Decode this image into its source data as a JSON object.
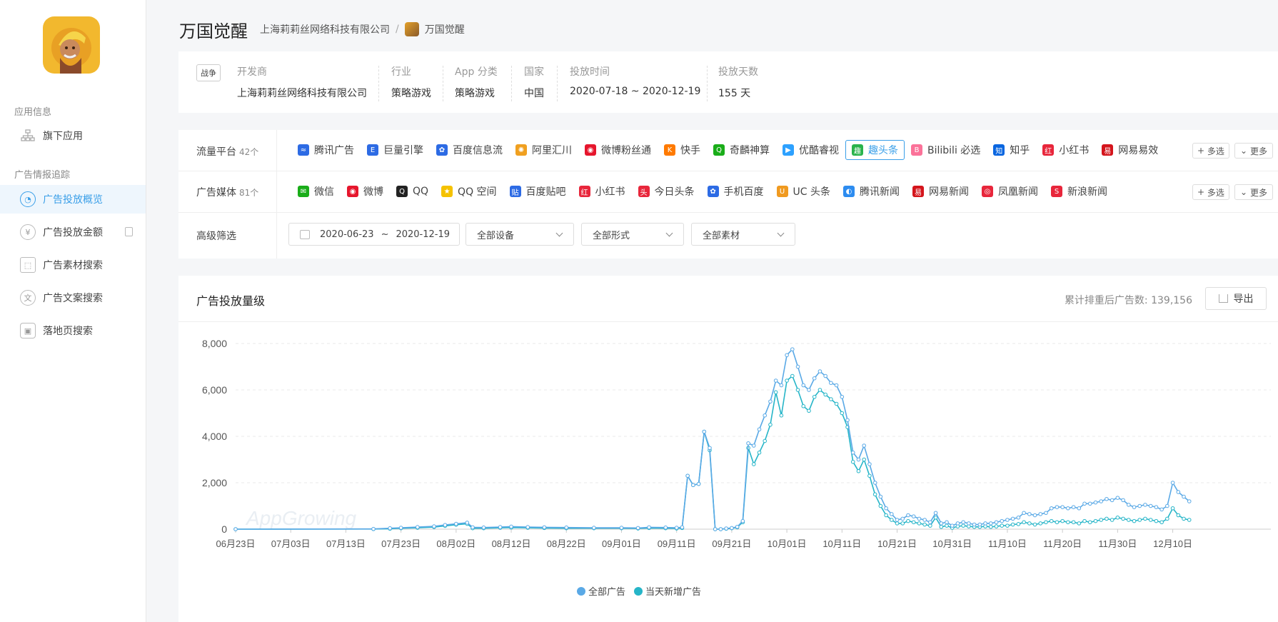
{
  "sidebar": {
    "section_app": "应用信息",
    "item_sub_apps": "旗下应用",
    "section_ad": "广告情报追踪",
    "items": [
      {
        "label": "广告投放概览"
      },
      {
        "label": "广告投放金额"
      },
      {
        "label": "广告素材搜索"
      },
      {
        "label": "广告文案搜索"
      },
      {
        "label": "落地页搜索"
      }
    ]
  },
  "header": {
    "title": "万国觉醒",
    "crumb_company": "上海莉莉丝网络科技有限公司",
    "crumb_sep": "/",
    "crumb_app": "万国觉醒"
  },
  "info": {
    "genre_tag": "战争",
    "fields": [
      {
        "label": "开发商",
        "value": "上海莉莉丝网络科技有限公司"
      },
      {
        "label": "行业",
        "value": "策略游戏"
      },
      {
        "label": "App 分类",
        "value": "策略游戏"
      },
      {
        "label": "国家",
        "value": "中国"
      },
      {
        "label": "投放时间",
        "value": "2020-07-18 ~ 2020-12-19"
      },
      {
        "label": "投放天数",
        "value": "155 天"
      }
    ]
  },
  "filters": {
    "platform_label": "流量平台",
    "platform_count": "42个",
    "platforms": [
      {
        "label": "腾讯广告",
        "icon": "tencent-ads-icon",
        "color": "#2d6be4",
        "glyph": "≈"
      },
      {
        "label": "巨量引擎",
        "icon": "ocean-engine-icon",
        "color": "#2d6be4",
        "glyph": "E"
      },
      {
        "label": "百度信息流",
        "icon": "baidu-paw-icon",
        "color": "#2d6be4",
        "glyph": "✿"
      },
      {
        "label": "阿里汇川",
        "icon": "ali-huichuan-icon",
        "color": "#f0a020",
        "glyph": "✺"
      },
      {
        "label": "微博粉丝通",
        "icon": "weibo-icon",
        "color": "#e6162d",
        "glyph": "◉"
      },
      {
        "label": "快手",
        "icon": "kuaishou-icon",
        "color": "#ff7a00",
        "glyph": "K"
      },
      {
        "label": "奇麟神算",
        "icon": "qilin-icon",
        "color": "#1aad19",
        "glyph": "Q"
      },
      {
        "label": "优酷睿视",
        "icon": "youku-icon",
        "color": "#2da1ff",
        "glyph": "▶"
      },
      {
        "label": "趣头条",
        "icon": "qutoutiao-icon",
        "color": "#29b34b",
        "glyph": "趣",
        "selected": true
      },
      {
        "label": "Bilibili 必选",
        "icon": "bilibili-icon",
        "color": "#fb7299",
        "glyph": "B"
      },
      {
        "label": "知乎",
        "icon": "zhihu-icon",
        "color": "#0a66e0",
        "glyph": "知"
      },
      {
        "label": "小红书",
        "icon": "xiaohongshu-icon",
        "color": "#e8263b",
        "glyph": "红"
      },
      {
        "label": "网易易效",
        "icon": "netease-icon",
        "color": "#d4151c",
        "glyph": "易"
      }
    ],
    "media_label": "广告媒体",
    "media_count": "81个",
    "media": [
      {
        "label": "微信",
        "icon": "wechat-icon",
        "color": "#1aad19",
        "glyph": "✉"
      },
      {
        "label": "微博",
        "icon": "weibo-icon",
        "color": "#e6162d",
        "glyph": "◉"
      },
      {
        "label": "QQ",
        "icon": "qq-icon",
        "color": "#222222",
        "glyph": "Q"
      },
      {
        "label": "QQ 空间",
        "icon": "qzone-icon",
        "color": "#f5c200",
        "glyph": "★"
      },
      {
        "label": "百度贴吧",
        "icon": "tieba-icon",
        "color": "#2d6be4",
        "glyph": "贴"
      },
      {
        "label": "小红书",
        "icon": "xiaohongshu-icon",
        "color": "#e8263b",
        "glyph": "红"
      },
      {
        "label": "今日头条",
        "icon": "toutiao-icon",
        "color": "#e8263b",
        "glyph": "头"
      },
      {
        "label": "手机百度",
        "icon": "baidu-paw-icon",
        "color": "#2d6be4",
        "glyph": "✿"
      },
      {
        "label": "UC 头条",
        "icon": "uc-icon",
        "color": "#f09a20",
        "glyph": "U"
      },
      {
        "label": "腾讯新闻",
        "icon": "tencent-news-icon",
        "color": "#2d8cf0",
        "glyph": "◐"
      },
      {
        "label": "网易新闻",
        "icon": "netease-news-icon",
        "color": "#d4151c",
        "glyph": "易"
      },
      {
        "label": "凤凰新闻",
        "icon": "ifeng-icon",
        "color": "#e8263b",
        "glyph": "◎"
      },
      {
        "label": "新浪新闻",
        "icon": "sina-news-icon",
        "color": "#e8263b",
        "glyph": "S"
      }
    ],
    "multi_select": "多选",
    "more": "更多",
    "advanced_label": "高级筛选",
    "date_start": "2020-06-23",
    "date_sep": "~",
    "date_end": "2020-12-19",
    "device": "全部设备",
    "format": "全部形式",
    "material": "全部素材"
  },
  "chart_card": {
    "title": "广告投放量级",
    "count_text": "累计排重后广告数: 139,156",
    "export": "导出",
    "watermark": "AppGrowing"
  },
  "colors": {
    "accent": "#3a9fe8",
    "series_all": "#5aa9e6",
    "series_new": "#26b5c8"
  },
  "chart_data": {
    "type": "line",
    "x_tick_labels": [
      "06月23日",
      "07月03日",
      "07月13日",
      "07月23日",
      "08月02日",
      "08月12日",
      "08月22日",
      "09月01日",
      "09月11日",
      "09月21日",
      "10月01日",
      "10月11日",
      "10月21日",
      "10月31日",
      "11月10日",
      "11月20日",
      "11月30日",
      "12月10日"
    ],
    "y_ticks": [
      "0",
      "2,000",
      "4,000",
      "6,000",
      "8,000"
    ],
    "ylim": [
      0,
      8000
    ],
    "x_range_days": [
      0,
      179
    ],
    "legend": [
      "全部广告",
      "当天新增广告"
    ],
    "series": [
      {
        "name": "全部广告",
        "points": [
          [
            0,
            0
          ],
          [
            25,
            10
          ],
          [
            28,
            40
          ],
          [
            30,
            60
          ],
          [
            33,
            90
          ],
          [
            36,
            120
          ],
          [
            38,
            180
          ],
          [
            40,
            230
          ],
          [
            42,
            280
          ],
          [
            43,
            80
          ],
          [
            45,
            70
          ],
          [
            48,
            90
          ],
          [
            50,
            110
          ],
          [
            53,
            90
          ],
          [
            56,
            80
          ],
          [
            60,
            70
          ],
          [
            65,
            60
          ],
          [
            70,
            60
          ],
          [
            73,
            50
          ],
          [
            75,
            80
          ],
          [
            78,
            70
          ],
          [
            80,
            60
          ],
          [
            81,
            80
          ],
          [
            82,
            2300
          ],
          [
            83,
            1900
          ],
          [
            84,
            1950
          ],
          [
            85,
            4200
          ],
          [
            86,
            3500
          ],
          [
            87,
            0
          ],
          [
            88,
            0
          ],
          [
            89,
            30
          ],
          [
            90,
            50
          ],
          [
            91,
            100
          ],
          [
            92,
            350
          ],
          [
            93,
            3700
          ],
          [
            94,
            3600
          ],
          [
            95,
            4300
          ],
          [
            96,
            4900
          ],
          [
            97,
            5500
          ],
          [
            98,
            6400
          ],
          [
            99,
            6200
          ],
          [
            100,
            7500
          ],
          [
            101,
            7750
          ],
          [
            102,
            7000
          ],
          [
            103,
            6200
          ],
          [
            104,
            6000
          ],
          [
            105,
            6500
          ],
          [
            106,
            6800
          ],
          [
            107,
            6600
          ],
          [
            108,
            6300
          ],
          [
            109,
            6200
          ],
          [
            110,
            5700
          ],
          [
            111,
            4700
          ],
          [
            112,
            3300
          ],
          [
            113,
            3000
          ],
          [
            114,
            3600
          ],
          [
            115,
            2800
          ],
          [
            116,
            2000
          ],
          [
            117,
            1400
          ],
          [
            118,
            900
          ],
          [
            119,
            650
          ],
          [
            120,
            400
          ],
          [
            121,
            450
          ],
          [
            122,
            600
          ],
          [
            123,
            550
          ],
          [
            124,
            450
          ],
          [
            125,
            400
          ],
          [
            126,
            300
          ],
          [
            127,
            700
          ],
          [
            128,
            250
          ],
          [
            129,
            300
          ],
          [
            130,
            150
          ],
          [
            131,
            250
          ],
          [
            132,
            300
          ],
          [
            133,
            250
          ],
          [
            134,
            200
          ],
          [
            135,
            200
          ],
          [
            136,
            250
          ],
          [
            137,
            250
          ],
          [
            138,
            300
          ],
          [
            139,
            350
          ],
          [
            140,
            400
          ],
          [
            141,
            450
          ],
          [
            142,
            500
          ],
          [
            143,
            700
          ],
          [
            144,
            650
          ],
          [
            145,
            600
          ],
          [
            146,
            650
          ],
          [
            147,
            700
          ],
          [
            148,
            900
          ],
          [
            149,
            950
          ],
          [
            150,
            950
          ],
          [
            151,
            900
          ],
          [
            152,
            950
          ],
          [
            153,
            900
          ],
          [
            154,
            1100
          ],
          [
            155,
            1100
          ],
          [
            156,
            1150
          ],
          [
            157,
            1200
          ],
          [
            158,
            1300
          ],
          [
            159,
            1250
          ],
          [
            160,
            1350
          ],
          [
            161,
            1250
          ],
          [
            162,
            1050
          ],
          [
            163,
            950
          ],
          [
            164,
            1000
          ],
          [
            165,
            1050
          ],
          [
            166,
            1000
          ],
          [
            167,
            950
          ],
          [
            168,
            850
          ],
          [
            169,
            1000
          ],
          [
            170,
            2000
          ],
          [
            171,
            1600
          ],
          [
            172,
            1400
          ],
          [
            173,
            1200
          ]
        ]
      },
      {
        "name": "当天新增广告",
        "points": [
          [
            0,
            0
          ],
          [
            25,
            5
          ],
          [
            28,
            20
          ],
          [
            30,
            40
          ],
          [
            33,
            60
          ],
          [
            36,
            90
          ],
          [
            38,
            140
          ],
          [
            40,
            190
          ],
          [
            42,
            230
          ],
          [
            43,
            40
          ],
          [
            45,
            40
          ],
          [
            48,
            60
          ],
          [
            50,
            70
          ],
          [
            53,
            60
          ],
          [
            56,
            50
          ],
          [
            60,
            40
          ],
          [
            65,
            40
          ],
          [
            70,
            40
          ],
          [
            73,
            30
          ],
          [
            75,
            50
          ],
          [
            78,
            40
          ],
          [
            80,
            30
          ],
          [
            81,
            50
          ],
          [
            82,
            2300
          ],
          [
            83,
            1900
          ],
          [
            84,
            1950
          ],
          [
            85,
            4200
          ],
          [
            86,
            3400
          ],
          [
            87,
            0
          ],
          [
            88,
            0
          ],
          [
            89,
            20
          ],
          [
            90,
            40
          ],
          [
            91,
            80
          ],
          [
            92,
            300
          ],
          [
            93,
            3500
          ],
          [
            94,
            2800
          ],
          [
            95,
            3300
          ],
          [
            96,
            3800
          ],
          [
            97,
            4500
          ],
          [
            98,
            5900
          ],
          [
            99,
            4900
          ],
          [
            100,
            6400
          ],
          [
            101,
            6600
          ],
          [
            102,
            6000
          ],
          [
            103,
            5300
          ],
          [
            104,
            5100
          ],
          [
            105,
            5700
          ],
          [
            106,
            6000
          ],
          [
            107,
            5800
          ],
          [
            108,
            5600
          ],
          [
            109,
            5400
          ],
          [
            110,
            5000
          ],
          [
            111,
            4400
          ],
          [
            112,
            2900
          ],
          [
            113,
            2500
          ],
          [
            114,
            3000
          ],
          [
            115,
            2300
          ],
          [
            116,
            1500
          ],
          [
            117,
            1000
          ],
          [
            118,
            600
          ],
          [
            119,
            400
          ],
          [
            120,
            250
          ],
          [
            121,
            250
          ],
          [
            122,
            350
          ],
          [
            123,
            300
          ],
          [
            124,
            250
          ],
          [
            125,
            200
          ],
          [
            126,
            150
          ],
          [
            127,
            500
          ],
          [
            128,
            100
          ],
          [
            129,
            150
          ],
          [
            130,
            60
          ],
          [
            131,
            120
          ],
          [
            132,
            150
          ],
          [
            133,
            120
          ],
          [
            134,
            100
          ],
          [
            135,
            100
          ],
          [
            136,
            120
          ],
          [
            137,
            100
          ],
          [
            138,
            120
          ],
          [
            139,
            150
          ],
          [
            140,
            150
          ],
          [
            141,
            200
          ],
          [
            142,
            220
          ],
          [
            143,
            300
          ],
          [
            144,
            250
          ],
          [
            145,
            200
          ],
          [
            146,
            250
          ],
          [
            147,
            300
          ],
          [
            148,
            350
          ],
          [
            149,
            300
          ],
          [
            150,
            350
          ],
          [
            151,
            300
          ],
          [
            152,
            300
          ],
          [
            153,
            250
          ],
          [
            154,
            350
          ],
          [
            155,
            300
          ],
          [
            156,
            350
          ],
          [
            157,
            400
          ],
          [
            158,
            450
          ],
          [
            159,
            400
          ],
          [
            160,
            500
          ],
          [
            161,
            450
          ],
          [
            162,
            400
          ],
          [
            163,
            350
          ],
          [
            164,
            400
          ],
          [
            165,
            450
          ],
          [
            166,
            400
          ],
          [
            167,
            350
          ],
          [
            168,
            300
          ],
          [
            169,
            450
          ],
          [
            170,
            900
          ],
          [
            171,
            600
          ],
          [
            172,
            450
          ],
          [
            173,
            400
          ]
        ]
      }
    ],
    "grid": true,
    "legend_position": "bottom-center"
  }
}
